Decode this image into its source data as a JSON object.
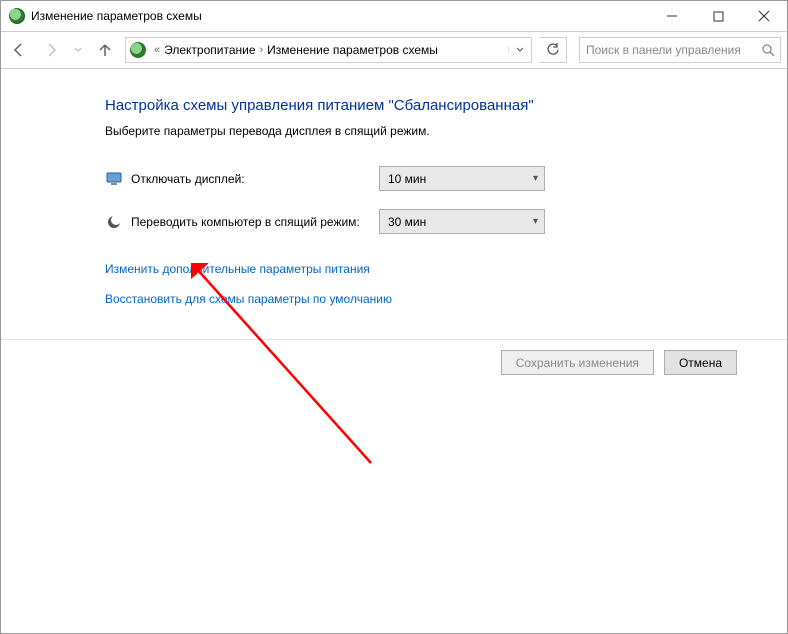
{
  "titlebar": {
    "title": "Изменение параметров схемы"
  },
  "breadcrumb": {
    "prefix": "«",
    "item1": "Электропитание",
    "item2": "Изменение параметров схемы"
  },
  "search": {
    "placeholder": "Поиск в панели управления"
  },
  "heading": "Настройка схемы управления питанием \"Сбалансированная\"",
  "subheading": "Выберите параметры перевода дисплея в спящий режим.",
  "settings": {
    "display_off": {
      "label": "Отключать дисплей:",
      "value": "10 мин"
    },
    "sleep": {
      "label": "Переводить компьютер в спящий режим:",
      "value": "30 мин"
    }
  },
  "links": {
    "advanced": "Изменить дополнительные параметры питания",
    "restore": "Восстановить для схемы параметры по умолчанию"
  },
  "buttons": {
    "save": "Сохранить изменения",
    "cancel": "Отмена"
  }
}
